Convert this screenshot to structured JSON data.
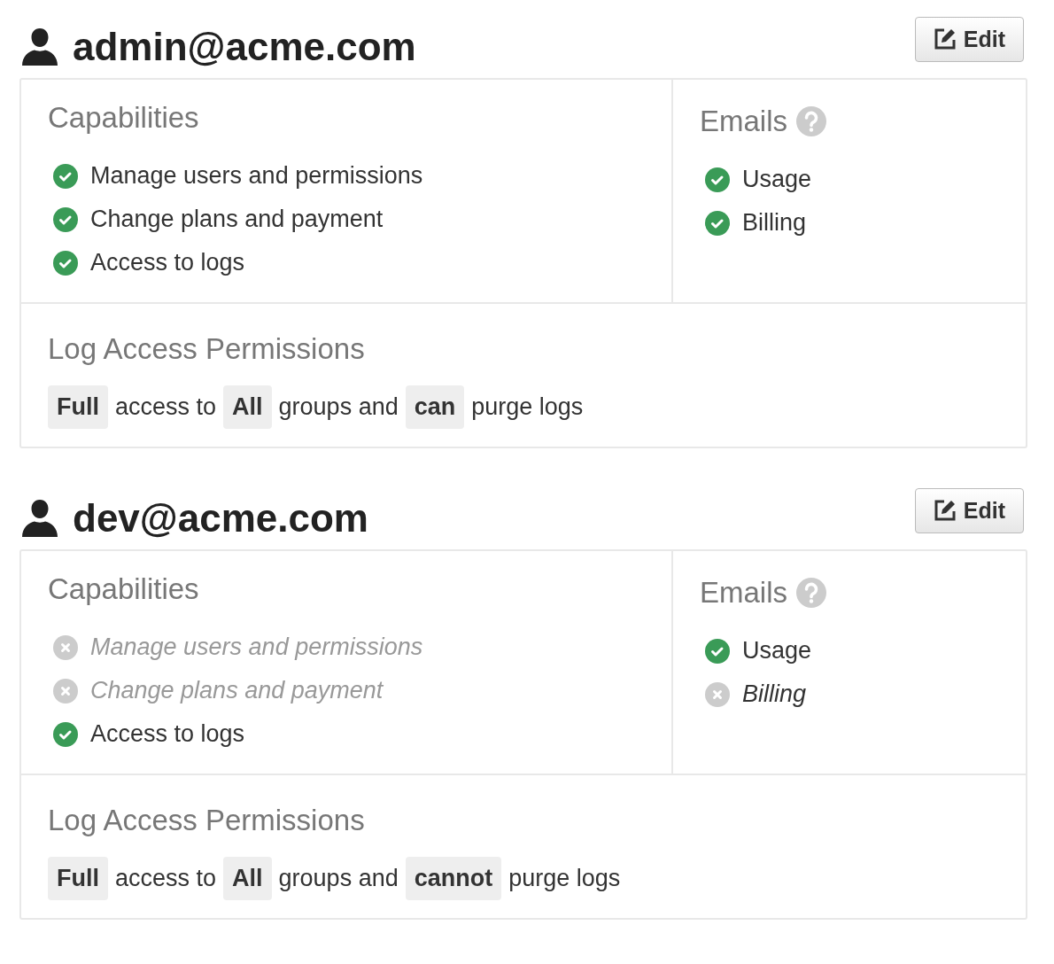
{
  "users": [
    {
      "email": "admin@acme.com",
      "edit_button": "Edit",
      "capabilities": {
        "title": "Capabilities",
        "items": [
          {
            "label": "Manage users and permissions",
            "enabled": true
          },
          {
            "label": "Change plans and payment",
            "enabled": true
          },
          {
            "label": "Access to logs",
            "enabled": true
          }
        ]
      },
      "emails": {
        "title": "Emails",
        "items": [
          {
            "label": "Usage",
            "enabled": true
          },
          {
            "label": "Billing",
            "enabled": true
          }
        ]
      },
      "log_access": {
        "title": "Log Access Permissions",
        "segments": [
          {
            "kind": "tag",
            "text": "Full"
          },
          {
            "kind": "text",
            "text": "access to"
          },
          {
            "kind": "tag",
            "text": "All"
          },
          {
            "kind": "text",
            "text": "groups and"
          },
          {
            "kind": "tag",
            "text": "can"
          },
          {
            "kind": "text",
            "text": "purge logs"
          }
        ]
      }
    },
    {
      "email": "dev@acme.com",
      "edit_button": "Edit",
      "capabilities": {
        "title": "Capabilities",
        "items": [
          {
            "label": "Manage users and permissions",
            "enabled": false
          },
          {
            "label": "Change plans and payment",
            "enabled": false
          },
          {
            "label": "Access to logs",
            "enabled": true
          }
        ]
      },
      "emails": {
        "title": "Emails",
        "items": [
          {
            "label": "Usage",
            "enabled": true
          },
          {
            "label": "Billing",
            "enabled": false
          }
        ]
      },
      "log_access": {
        "title": "Log Access Permissions",
        "segments": [
          {
            "kind": "tag",
            "text": "Full"
          },
          {
            "kind": "text",
            "text": "access to"
          },
          {
            "kind": "tag",
            "text": "All"
          },
          {
            "kind": "text",
            "text": "groups and"
          },
          {
            "kind": "tag",
            "text": "cannot"
          },
          {
            "kind": "text",
            "text": "purge logs"
          }
        ]
      }
    }
  ]
}
